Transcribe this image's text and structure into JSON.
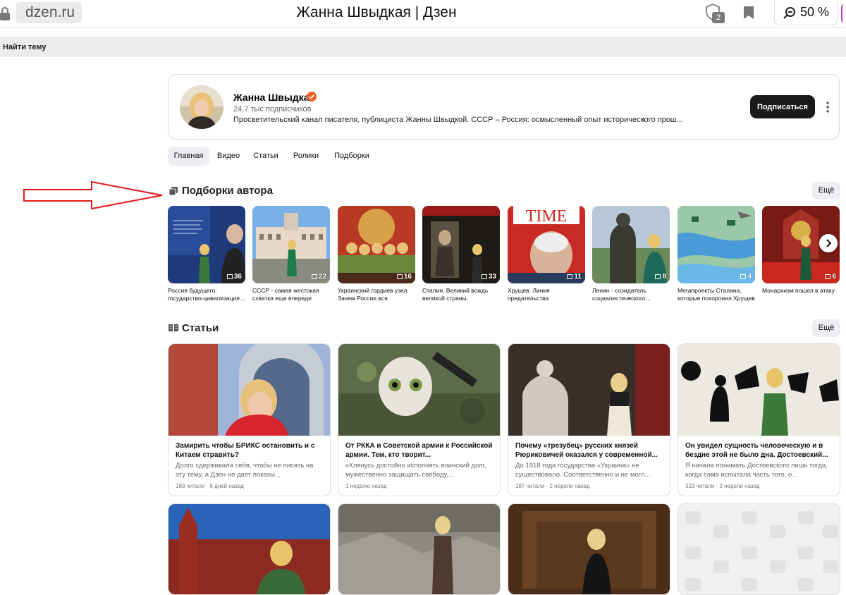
{
  "browser": {
    "url": "dzen.ru",
    "tab_title": "Жанна Швыдкая | Дзен",
    "shield_count": "2",
    "zoom": "50 %"
  },
  "topic_strip": {
    "label": "Найти тему"
  },
  "channel": {
    "name": "Жанна Швыдкая",
    "subscribers": "24,7 тыс подписчиков",
    "description": "Просветительский канал писателя, публициста Жанны Швыдкой. СССР – Россия: осмысленный опыт исторического прош...",
    "subscribe_label": "Подписаться",
    "verified_color": "#f25c1f"
  },
  "tabs": [
    {
      "label": "Главная",
      "active": true
    },
    {
      "label": "Видео"
    },
    {
      "label": "Статьи"
    },
    {
      "label": "Ролики"
    },
    {
      "label": "Подборки"
    }
  ],
  "collections_section": {
    "title": "Подборки автора",
    "more_label": "Ещё"
  },
  "collections": [
    {
      "title": "Россия будущего: государство-цивилизация...",
      "count": "36"
    },
    {
      "title": "СССР - самая жестокая схватка еще впереди",
      "count": "22"
    },
    {
      "title": "Украинский гордиев узел. Зачем России вся Украина?",
      "count": "16"
    },
    {
      "title": "Сталин. Великий вождь великой страны.",
      "count": "33"
    },
    {
      "title": "Хрущев. Линия предательства",
      "count": "11"
    },
    {
      "title": "Ленин - созидатель социалистического...",
      "count": "8"
    },
    {
      "title": "Мегапроекты Сталина, которые похоронил Хрущев",
      "count": "4"
    },
    {
      "title": "Монархизм пошел в атаку",
      "count": "6"
    }
  ],
  "articles_section": {
    "title": "Статьи",
    "more_label": "Ещё"
  },
  "articles": [
    {
      "title": "Замирить чтобы БРИКС остановить и с Китаем стравить?",
      "snippet": "Долго сдерживала себя, чтобы не писать на эту тему, а Дзен не дает показы...",
      "meta": "183 читали · 6 дней назад"
    },
    {
      "title": "От РККА и Советской армии к Российской армии. Тем, кто творит...",
      "snippet": "«Клянусь достойно исполнять воинский долг, мужественно защищать свободу,...",
      "meta": "1 неделю назад"
    },
    {
      "title": "Почему «трезубец» русских князей Рюриковичей оказался у современной...",
      "snippet": "До 1918 года государства «Украина» не существовало. Соответственно и не могл...",
      "meta": "187 читали · 2 недели назад"
    },
    {
      "title": "Он увидел сущность человеческую и в бездне этой не было дна. Достоевский...",
      "snippet": "Я начала понимать Достоевского лишь тогда, когда сама испытала часть того, о...",
      "meta": "323 читали · 3 недели назад"
    }
  ]
}
